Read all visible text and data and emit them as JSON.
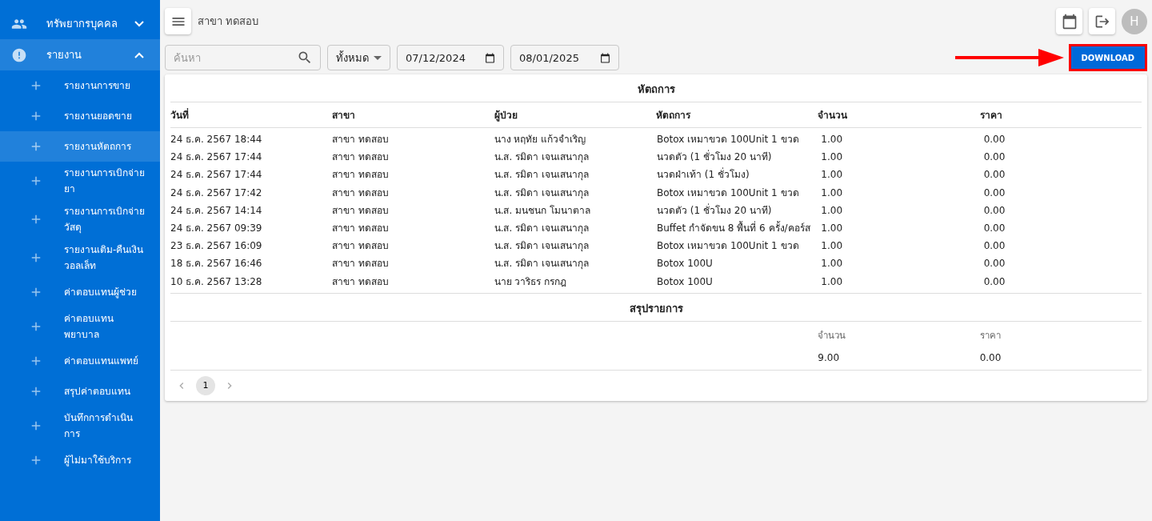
{
  "sidebar": {
    "groups": [
      {
        "label": "ทรัพยากรบุคคล",
        "expanded": false,
        "selected": false
      },
      {
        "label": "รายงาน",
        "expanded": true,
        "selected": true,
        "children": [
          {
            "label": "รายงานการขาย",
            "selected": false
          },
          {
            "label": "รายงานยอดขาย",
            "selected": false
          },
          {
            "label": "รายงานหัตถการ",
            "selected": true
          },
          {
            "label": "รายงานการเบิกจ่ายยา",
            "selected": false
          },
          {
            "label": "รายงานการเบิกจ่ายวัสดุ",
            "selected": false
          },
          {
            "label": "รายงานเติม-คืนเงินวอลเล็ท",
            "selected": false
          },
          {
            "label": "ค่าตอบแทนผู้ช่วย",
            "selected": false
          },
          {
            "label": "ค่าตอบแทนพยาบาล",
            "selected": false
          },
          {
            "label": "ค่าตอบแทนแพทย์",
            "selected": false
          },
          {
            "label": "สรุปค่าตอบแทน",
            "selected": false
          },
          {
            "label": "บันทึกการดำเนินการ",
            "selected": false
          },
          {
            "label": "ผู้ไม่มาใช้บริการ",
            "selected": false
          }
        ]
      }
    ]
  },
  "header": {
    "branch": "สาขา ทดสอบ",
    "avatar": "H"
  },
  "filters": {
    "search": {
      "placeholder": "ค้นหา"
    },
    "select": {
      "value": "ทั้งหมด"
    },
    "date_from": "07/12/2024",
    "date_to": "08/01/2025"
  },
  "download": {
    "label": "DOWNLOAD",
    "highlighted": true
  },
  "table": {
    "title": "หัตถการ",
    "columns": [
      "วันที่",
      "สาขา",
      "ผู้ป่วย",
      "หัตถการ",
      "จำนวน",
      "ราคา"
    ],
    "rows": [
      [
        "24 ธ.ค. 2567 18:44",
        "สาขา ทดสอบ",
        "นาง หฤทัย แก้วจำเริญ",
        "Botox เหมาขวด 100Unit 1 ขวด",
        "1.00",
        "0.00"
      ],
      [
        "24 ธ.ค. 2567 17:44",
        "สาขา ทดสอบ",
        "น.ส. รมิดา เจนเสนากุล",
        "นวดตัว (1 ชั่วโมง 20 นาที)",
        "1.00",
        "0.00"
      ],
      [
        "24 ธ.ค. 2567 17:44",
        "สาขา ทดสอบ",
        "น.ส. รมิดา เจนเสนากุล",
        "นวดฝ่าเท้า (1 ชั่วโมง)",
        "1.00",
        "0.00"
      ],
      [
        "24 ธ.ค. 2567 17:42",
        "สาขา ทดสอบ",
        "น.ส. รมิดา เจนเสนากุล",
        "Botox เหมาขวด 100Unit 1 ขวด",
        "1.00",
        "0.00"
      ],
      [
        "24 ธ.ค. 2567 14:14",
        "สาขา ทดสอบ",
        "น.ส. มนชนก โมนาตาล",
        "นวดตัว (1 ชั่วโมง 20 นาที)",
        "1.00",
        "0.00"
      ],
      [
        "24 ธ.ค. 2567 09:39",
        "สาขา ทดสอบ",
        "น.ส. รมิดา เจนเสนากุล",
        "Buffet กำจัดขน 8 พื้นที่ 6 ครั้ง/คอร์ส",
        "1.00",
        "0.00"
      ],
      [
        "23 ธ.ค. 2567 16:09",
        "สาขา ทดสอบ",
        "น.ส. รมิดา เจนเสนากุล",
        "Botox เหมาขวด 100Unit 1 ขวด",
        "1.00",
        "0.00"
      ],
      [
        "18 ธ.ค. 2567 16:46",
        "สาขา ทดสอบ",
        "น.ส. รมิดา เจนเสนากุล",
        "Botox 100U",
        "1.00",
        "0.00"
      ],
      [
        "10 ธ.ค. 2567 13:28",
        "สาขา ทดสอบ",
        "นาย วาริธร กรกฎ",
        "Botox 100U",
        "1.00",
        "0.00"
      ]
    ]
  },
  "summary": {
    "title": "สรุปรายการ",
    "labels": [
      "จำนวน",
      "ราคา"
    ],
    "values": [
      "9.00",
      "0.00"
    ]
  },
  "pagination": {
    "pages": [
      {
        "label": "1",
        "selected": true
      }
    ]
  }
}
